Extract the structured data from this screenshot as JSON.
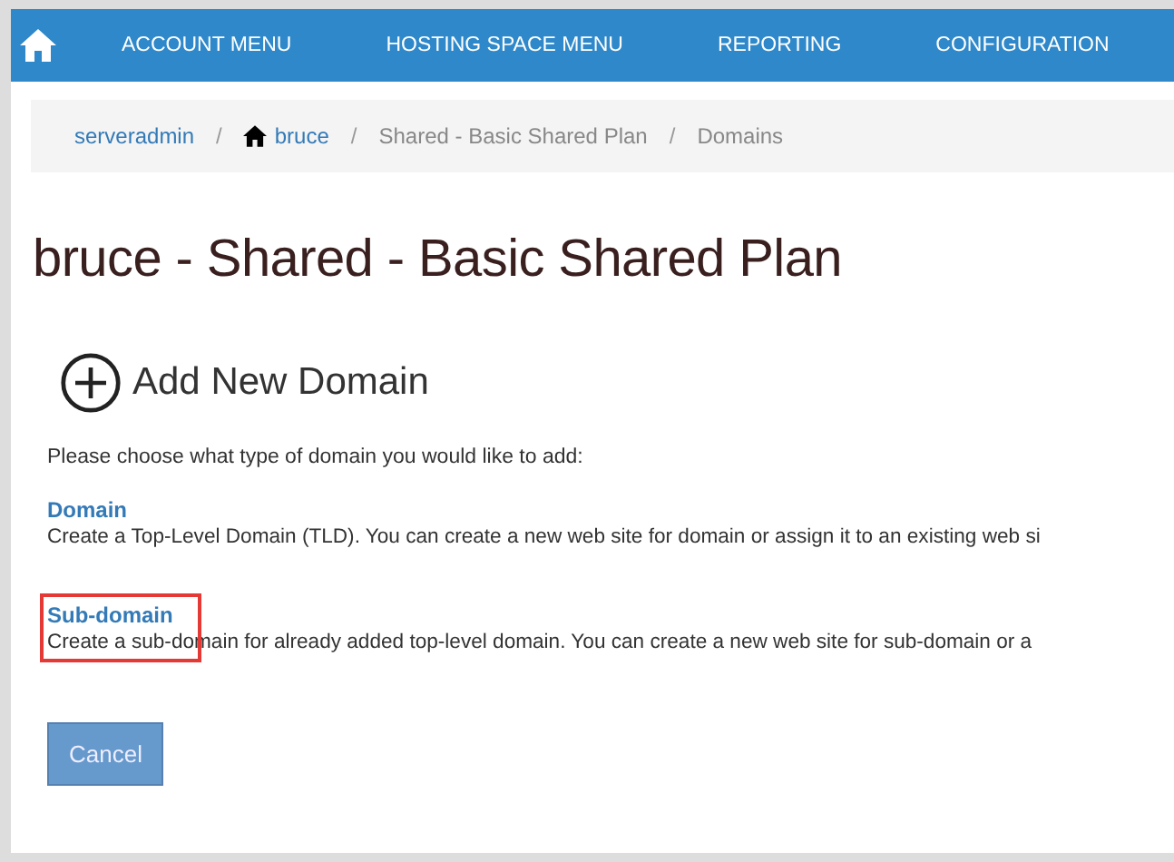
{
  "nav": {
    "items": [
      "ACCOUNT MENU",
      "HOSTING SPACE MENU",
      "REPORTING",
      "CONFIGURATION"
    ]
  },
  "breadcrumb": [
    {
      "text": "serveradmin",
      "kind": "link"
    },
    {
      "text": "/",
      "kind": "separator"
    },
    {
      "text": "bruce",
      "kind": "home-link"
    },
    {
      "text": "/",
      "kind": "separator"
    },
    {
      "text": "Shared - Basic Shared Plan",
      "kind": "text"
    },
    {
      "text": "/",
      "kind": "separator"
    },
    {
      "text": "Domains",
      "kind": "text"
    }
  ],
  "page_title": "bruce - Shared - Basic Shared Plan",
  "section_title": "Add New Domain",
  "intro": "Please choose what type of domain you would like to add:",
  "options": [
    {
      "title": "Domain",
      "description": "Create a Top-Level Domain (TLD). You can create a new web site for domain or assign it to an existing web si",
      "highlighted": false
    },
    {
      "title": "Sub-domain",
      "description": "Create a sub-domain for already added top-level domain. You can create a new web site for sub-domain or a",
      "highlighted": true
    }
  ],
  "buttons": [
    "Cancel"
  ]
}
